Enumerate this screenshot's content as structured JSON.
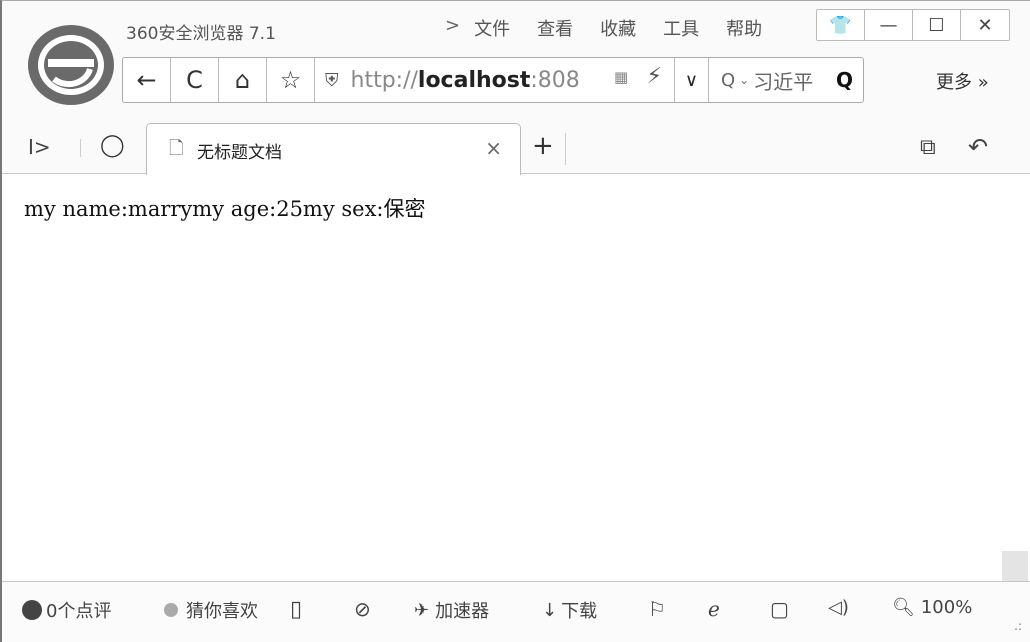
{
  "titlebar": {
    "app_title": "360安全浏览器 7.1",
    "menu_chevron": ">",
    "menu": [
      "文件",
      "查看",
      "收藏",
      "工具",
      "帮助"
    ],
    "controls": {
      "skin": "👕",
      "minimize": "—",
      "maximize": "☐",
      "close": "✕"
    }
  },
  "navbar": {
    "back": "←",
    "refresh": "C",
    "home": "⌂",
    "favorite": "☆",
    "shield": "⛨",
    "url_scheme": "http://",
    "url_host": "localhost",
    "url_rest": ":808",
    "qr": "▦",
    "bolt": "⚡",
    "dropdown": "∨",
    "search_icon": "Q",
    "search_dropdown": "⌄",
    "search_text": "习近平",
    "search_go": "Q",
    "more": "更多 »"
  },
  "tabbar": {
    "sidebar_toggle": "I>",
    "cloud": "◯",
    "tab_label": "无标题文档",
    "tab_close": "×",
    "new_tab": "+",
    "restore_icon": "⧉",
    "undo_icon": "↶"
  },
  "page": {
    "body_text": "my name:marrymy age:25my sex:保密"
  },
  "statusbar": {
    "reviews": "0个点评",
    "guess": "猜你喜欢",
    "mobile_icon": "▯",
    "accel_label": "加速器",
    "download_label": "下载",
    "zoom": "100%",
    "grip": ".:"
  }
}
